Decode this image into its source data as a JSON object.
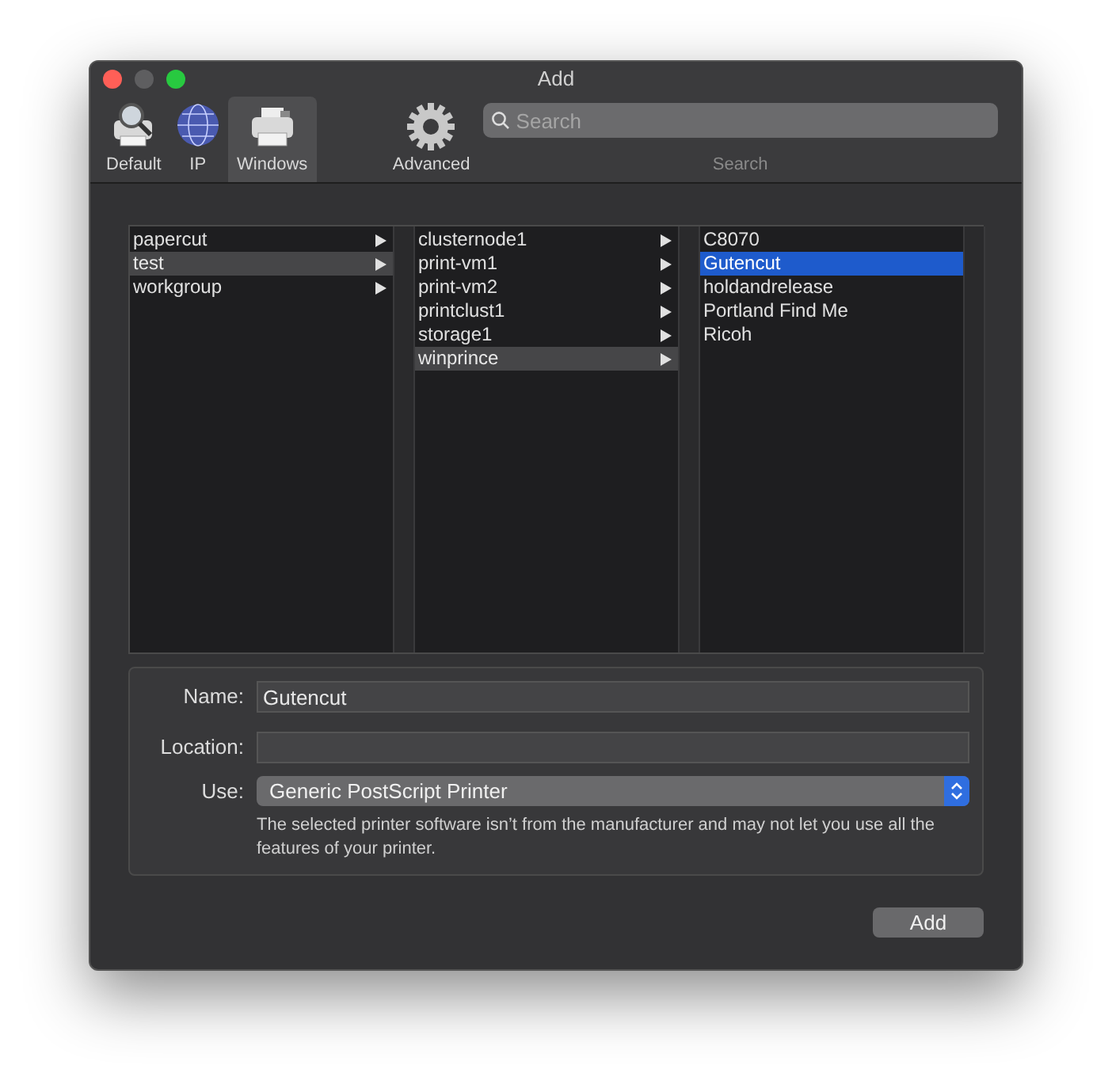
{
  "window": {
    "title": "Add"
  },
  "toolbar": {
    "tabs": [
      {
        "label": "Default",
        "kind": "printer-search",
        "selected": false
      },
      {
        "label": "IP",
        "kind": "globe",
        "selected": false
      },
      {
        "label": "Windows",
        "kind": "printer",
        "selected": true
      }
    ],
    "advanced": {
      "label": "Advanced"
    },
    "search": {
      "placeholder": "Search",
      "caption": "Search"
    }
  },
  "browser": {
    "columns": [
      {
        "focused": false,
        "items": [
          {
            "label": "papercut",
            "selected": false,
            "has_children": true
          },
          {
            "label": "test",
            "selected": true,
            "has_children": true
          },
          {
            "label": "workgroup",
            "selected": false,
            "has_children": true
          }
        ]
      },
      {
        "focused": false,
        "items": [
          {
            "label": "clusternode1",
            "selected": false,
            "has_children": true
          },
          {
            "label": "print-vm1",
            "selected": false,
            "has_children": true
          },
          {
            "label": "print-vm2",
            "selected": false,
            "has_children": true
          },
          {
            "label": "printclust1",
            "selected": false,
            "has_children": true
          },
          {
            "label": "storage1",
            "selected": false,
            "has_children": true
          },
          {
            "label": "winprince",
            "selected": true,
            "has_children": true
          }
        ]
      },
      {
        "focused": true,
        "items": [
          {
            "label": "C8070",
            "selected": false,
            "has_children": false
          },
          {
            "label": "Gutencut",
            "selected": true,
            "has_children": false
          },
          {
            "label": "holdandrelease",
            "selected": false,
            "has_children": false
          },
          {
            "label": "Portland Find Me",
            "selected": false,
            "has_children": false
          },
          {
            "label": "Ricoh",
            "selected": false,
            "has_children": false
          }
        ]
      }
    ]
  },
  "form": {
    "name": {
      "label": "Name:",
      "value": "Gutencut"
    },
    "location": {
      "label": "Location:"
    },
    "use": {
      "label": "Use:",
      "value": "Generic PostScript Printer"
    },
    "note": "The selected printer software isn’t from the manufacturer and may not let you use all the features of your printer."
  },
  "buttons": [
    {
      "label": "Add"
    }
  ]
}
